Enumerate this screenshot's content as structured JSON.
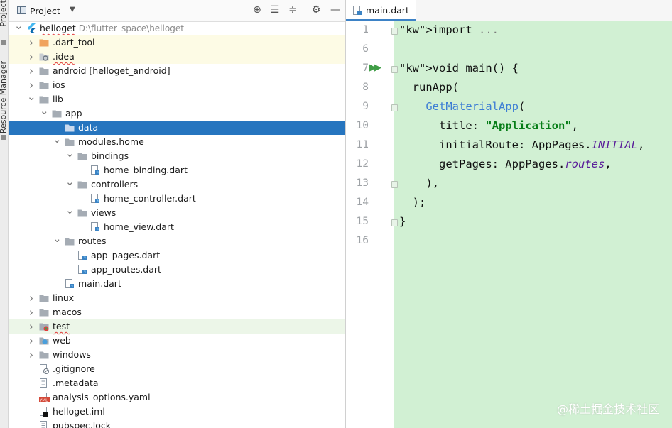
{
  "side_strip": {
    "project": "Project",
    "resource_manager": "Resource Manager"
  },
  "project_panel": {
    "title": "Project",
    "tree": [
      {
        "label": "helloget",
        "path": "D:\\flutter_space\\helloget",
        "level": 0,
        "chevron": "down",
        "icon": "flutter-icon"
      },
      {
        "label": ".dart_tool",
        "level": 1,
        "chevron": "right",
        "icon": "folder-orange-icon"
      },
      {
        "label": ".idea",
        "level": 1,
        "chevron": "right",
        "icon": "folder-settings-icon"
      },
      {
        "label": "android [helloget_android]",
        "level": 1,
        "chevron": "right",
        "icon": "folder-icon"
      },
      {
        "label": "ios",
        "level": 1,
        "chevron": "right",
        "icon": "folder-icon"
      },
      {
        "label": "lib",
        "level": 1,
        "chevron": "down",
        "icon": "folder-icon"
      },
      {
        "label": "app",
        "level": 2,
        "chevron": "down",
        "icon": "folder-icon"
      },
      {
        "label": "data",
        "level": 3,
        "chevron": "",
        "icon": "folder-icon",
        "selected": true
      },
      {
        "label": "modules.home",
        "level": 3,
        "chevron": "down",
        "icon": "folder-icon"
      },
      {
        "label": "bindings",
        "level": 4,
        "chevron": "down",
        "icon": "folder-icon"
      },
      {
        "label": "home_binding.dart",
        "level": 5,
        "chevron": "",
        "icon": "dart-file-icon"
      },
      {
        "label": "controllers",
        "level": 4,
        "chevron": "down",
        "icon": "folder-icon"
      },
      {
        "label": "home_controller.dart",
        "level": 5,
        "chevron": "",
        "icon": "dart-file-icon"
      },
      {
        "label": "views",
        "level": 4,
        "chevron": "down",
        "icon": "folder-icon"
      },
      {
        "label": "home_view.dart",
        "level": 5,
        "chevron": "",
        "icon": "dart-file-icon"
      },
      {
        "label": "routes",
        "level": 3,
        "chevron": "down",
        "icon": "folder-icon"
      },
      {
        "label": "app_pages.dart",
        "level": 4,
        "chevron": "",
        "icon": "dart-file-icon"
      },
      {
        "label": "app_routes.dart",
        "level": 4,
        "chevron": "",
        "icon": "dart-file-icon"
      },
      {
        "label": "main.dart",
        "level": 3,
        "chevron": "",
        "icon": "dart-file-icon"
      },
      {
        "label": "linux",
        "level": 1,
        "chevron": "right",
        "icon": "folder-icon"
      },
      {
        "label": "macos",
        "level": 1,
        "chevron": "right",
        "icon": "folder-icon"
      },
      {
        "label": "test",
        "level": 1,
        "chevron": "right",
        "icon": "folder-test-icon"
      },
      {
        "label": "web",
        "level": 1,
        "chevron": "right",
        "icon": "folder-web-icon"
      },
      {
        "label": "windows",
        "level": 1,
        "chevron": "right",
        "icon": "folder-icon"
      },
      {
        "label": ".gitignore",
        "level": 1,
        "chevron": "",
        "icon": "gitignore-file-icon"
      },
      {
        "label": ".metadata",
        "level": 1,
        "chevron": "",
        "icon": "text-file-icon"
      },
      {
        "label": "analysis_options.yaml",
        "level": 1,
        "chevron": "",
        "icon": "yaml-file-icon"
      },
      {
        "label": "helloget.iml",
        "level": 1,
        "chevron": "",
        "icon": "iml-file-icon"
      },
      {
        "label": "pubspec.lock",
        "level": 1,
        "chevron": "",
        "icon": "text-file-icon"
      }
    ]
  },
  "editor": {
    "tab_label": "main.dart",
    "lines": [
      {
        "num": "1",
        "text": "import ..."
      },
      {
        "num": "6",
        "text": ""
      },
      {
        "num": "7",
        "text": "void main() {"
      },
      {
        "num": "8",
        "text": "  runApp("
      },
      {
        "num": "9",
        "text": "    GetMaterialApp("
      },
      {
        "num": "10",
        "text": "      title: \"Application\","
      },
      {
        "num": "11",
        "text": "      initialRoute: AppPages.INITIAL,"
      },
      {
        "num": "12",
        "text": "      getPages: AppPages.routes,"
      },
      {
        "num": "13",
        "text": "    ),"
      },
      {
        "num": "14",
        "text": "  );"
      },
      {
        "num": "15",
        "text": "}"
      },
      {
        "num": "16",
        "text": ""
      }
    ]
  },
  "watermark": "@稀土掘金技术社区"
}
